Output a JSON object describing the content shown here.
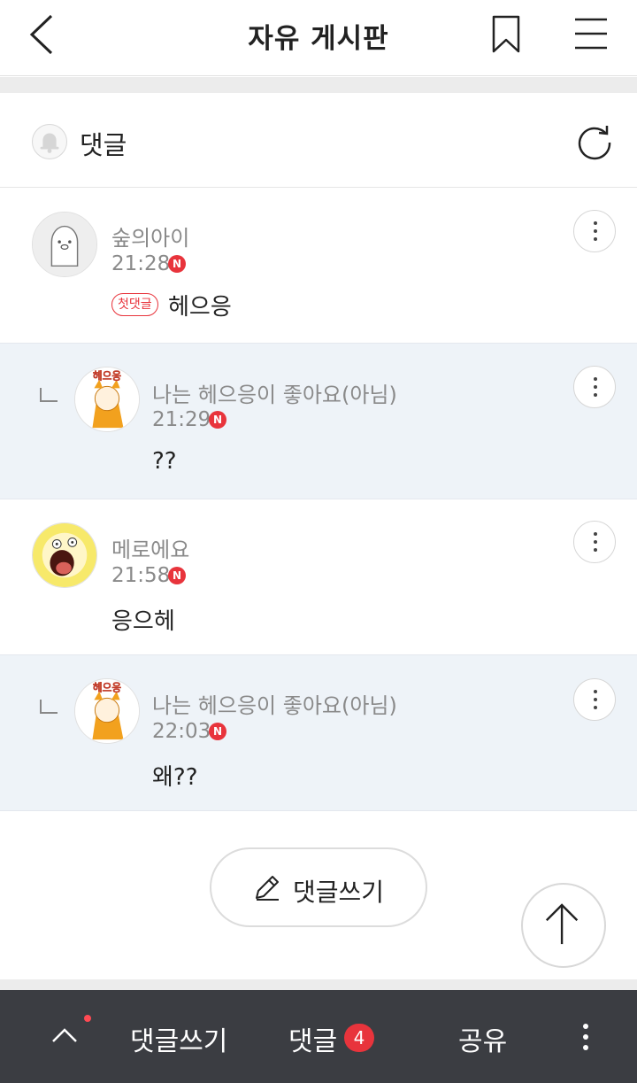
{
  "header": {
    "title": "자유 게시판",
    "back_icon": "chevron-left-icon",
    "bookmark_icon": "bookmark-icon",
    "menu_icon": "hamburger-menu-icon"
  },
  "comments_header": {
    "label": "댓글",
    "bell_icon": "bell-icon",
    "refresh_icon": "refresh-icon"
  },
  "comments": [
    {
      "author": "숲의아이",
      "time": "21:28",
      "badge": "N",
      "tag": "첫댓글",
      "text": "헤으응",
      "reply": false
    },
    {
      "author": "나는 헤으응이 좋아요(아님)",
      "time": "21:29",
      "badge": "N",
      "text": "??",
      "reply": true,
      "avatar_text": "헤으응"
    },
    {
      "author": "메로에요",
      "time": "21:58",
      "badge": "N",
      "text": "응으헤",
      "reply": false
    },
    {
      "author": "나는 헤으응이 좋아요(아님)",
      "time": "22:03",
      "badge": "N",
      "text": "왜??",
      "reply": true,
      "avatar_text": "헤으응"
    }
  ],
  "write_button": {
    "label": "댓글쓰기",
    "icon": "pencil-icon"
  },
  "scroll_top_icon": "arrow-up-icon",
  "bottom_bar": {
    "write_label": "댓글쓰기",
    "comments_label": "댓글",
    "comments_count": "4",
    "share_label": "공유",
    "accent_color": "#e8343c",
    "background_color": "#3b3d42"
  }
}
